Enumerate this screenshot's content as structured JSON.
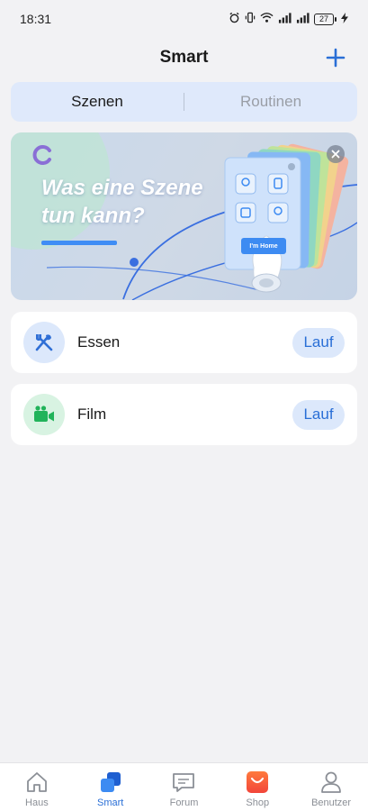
{
  "status_bar": {
    "time": "18:31",
    "battery": "27"
  },
  "header": {
    "title": "Smart"
  },
  "tabs": [
    {
      "label": "Szenen",
      "active": true
    },
    {
      "label": "Routinen",
      "active": false
    }
  ],
  "banner": {
    "title_line1": "Was eine Szene",
    "title_line2": "tun kann?",
    "card_button": "I'm Home"
  },
  "scenes": [
    {
      "name": "Essen",
      "run_label": "Lauf",
      "icon": "fork-knife-icon",
      "icon_color": "#2f6fd6",
      "icon_bg": "#dce8fb"
    },
    {
      "name": "Film",
      "run_label": "Lauf",
      "icon": "video-camera-icon",
      "icon_color": "#21b35a",
      "icon_bg": "#d8f3e2"
    }
  ],
  "bottom_nav": [
    {
      "label": "Haus",
      "icon": "home-icon",
      "active": false
    },
    {
      "label": "Smart",
      "icon": "smart-icon",
      "active": true
    },
    {
      "label": "Forum",
      "icon": "forum-icon",
      "active": false
    },
    {
      "label": "Shop",
      "icon": "shop-icon",
      "active": false
    },
    {
      "label": "Benutzer",
      "icon": "user-icon",
      "active": false
    }
  ],
  "colors": {
    "accent": "#2a6fd6",
    "background": "#f2f2f4",
    "segment_bg": "#dfe9fb"
  }
}
